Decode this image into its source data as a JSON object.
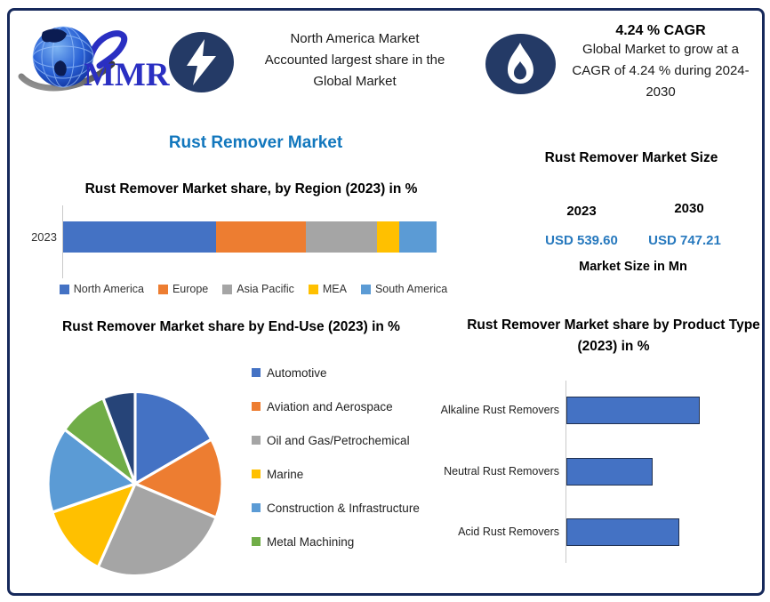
{
  "brand": {
    "logo_text": "MMR"
  },
  "header": {
    "na_callout": {
      "lines": [
        "North America Market",
        "Accounted largest share in the",
        "Global Market"
      ]
    },
    "cagr_callout": {
      "headline": "4.24 % CAGR",
      "lines": [
        "Global Market to grow at a",
        "CAGR of 4.24 % during 2024-",
        "2030"
      ]
    }
  },
  "main_title": "Rust Remover Market",
  "market_size_panel": {
    "title": "Rust Remover Market Size",
    "columns": [
      {
        "year": "2023",
        "value": "USD 539.60"
      },
      {
        "year": "2030",
        "value": "USD 747.21"
      }
    ],
    "unit_label": "Market Size in Mn"
  },
  "palette": {
    "blue": "#4472C4",
    "orange": "#ED7D31",
    "gray": "#A5A5A5",
    "yellow": "#FFC000",
    "light_blue": "#5B9BD5",
    "green": "#70AD47",
    "dark_navy": "#264478",
    "frame_navy": "#16295B",
    "badge_navy": "#243A66",
    "title_blue": "#1277BD",
    "value_blue": "#2779BE"
  },
  "chart_data": [
    {
      "type": "bar",
      "variant": "stacked-horizontal",
      "title": "Rust Remover Market share, by Region (2023) in %",
      "categories": [
        "2023"
      ],
      "series": [
        {
          "name": "North America",
          "value": 41,
          "color": "#4472C4"
        },
        {
          "name": "Europe",
          "value": 24,
          "color": "#ED7D31"
        },
        {
          "name": "Asia Pacific",
          "value": 19,
          "color": "#A5A5A5"
        },
        {
          "name": "MEA",
          "value": 6,
          "color": "#FFC000"
        },
        {
          "name": "South America",
          "value": 10,
          "color": "#5B9BD5"
        }
      ],
      "xlim": [
        0,
        100
      ],
      "legend_position": "bottom",
      "grid": false
    },
    {
      "type": "pie",
      "title": "Rust Remover Market share by End-Use (2023) in %",
      "slices": [
        {
          "label": "Automotive",
          "value": 17,
          "color": "#4472C4"
        },
        {
          "label": "Aviation and Aerospace",
          "value": 14,
          "color": "#ED7D31"
        },
        {
          "label": "Oil and Gas/Petrochemical",
          "value": 26,
          "color": "#A5A5A5"
        },
        {
          "label": "Marine",
          "value": 13,
          "color": "#FFC000"
        },
        {
          "label": "Construction & Infrastructure",
          "value": 15,
          "color": "#5B9BD5"
        },
        {
          "label": "Metal Machining",
          "value": 9,
          "color": "#70AD47"
        },
        {
          "label": "",
          "value": 6,
          "color": "#264478"
        }
      ],
      "legend_position": "right"
    },
    {
      "type": "bar",
      "variant": "horizontal",
      "title": "Rust Remover Market share by Product Type  (2023) in %",
      "categories": [
        "Alkaline Rust Removers",
        "Neutral Rust Removers",
        "Acid Rust Removers"
      ],
      "values": [
        45,
        29,
        38
      ],
      "bar_color": "#4472C4",
      "xlim": [
        0,
        60
      ],
      "grid": false
    }
  ]
}
